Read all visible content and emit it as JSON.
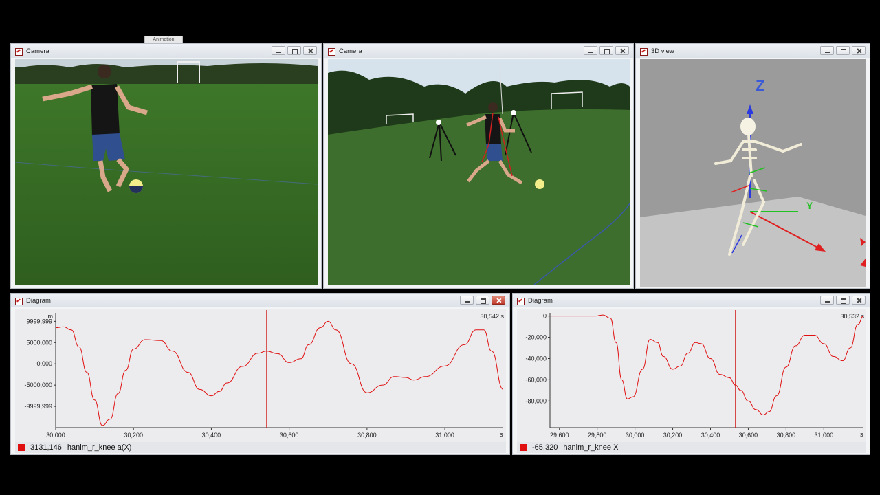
{
  "tooltip": "Animation",
  "windows": {
    "camera1": {
      "title": "Camera"
    },
    "camera2": {
      "title": "Camera"
    },
    "view3d": {
      "title": "3D view",
      "axis_z": "Z",
      "axis_y": "Y"
    },
    "diagram1": {
      "title": "Diagram",
      "unit": "m",
      "time_readout": "30,542 s",
      "y_ticks": [
        "9999,999",
        "5000,000",
        "0,000",
        "-5000,000",
        "-9999,999"
      ],
      "x_ticks": [
        "30,000",
        "30,200",
        "30,400",
        "30,600",
        "30,800",
        "31,000"
      ],
      "x_unit": "s",
      "footer_value": "3131,146",
      "footer_label": "hanim_r_knee a(X)",
      "series_color": "#e01010"
    },
    "diagram2": {
      "title": "Diagram",
      "time_readout": "30,532 s",
      "y_ticks": [
        "0",
        "-20,000",
        "-40,000",
        "-60,000",
        "-80,000"
      ],
      "x_ticks": [
        "29,600",
        "29,800",
        "30,000",
        "30,200",
        "30,400",
        "30,600",
        "30,800",
        "31,000"
      ],
      "x_unit": "s",
      "footer_value": "-65,320",
      "footer_label": "hanim_r_knee X",
      "series_color": "#e01010"
    }
  },
  "chart_data": [
    {
      "type": "line",
      "x": [
        30000,
        30020,
        30040,
        30060,
        30080,
        30100,
        30120,
        30140,
        30160,
        30180,
        30200,
        30230,
        30270,
        30300,
        30340,
        30370,
        30400,
        30420,
        30440,
        30480,
        30520,
        30542,
        30570,
        30600,
        30630,
        30650,
        30680,
        30700,
        30720,
        30760,
        30800,
        30840,
        30870,
        30900,
        30920,
        30950,
        31000,
        31050,
        31080,
        31100,
        31120,
        31150
      ],
      "series": [
        {
          "values": [
            8500,
            8700,
            8000,
            4000,
            -2000,
            -8500,
            -14500,
            -13000,
            -7000,
            -1500,
            3500,
            5700,
            5500,
            3000,
            -2000,
            -6000,
            -7500,
            -6500,
            -4500,
            -600,
            2500,
            3000,
            2400,
            300,
            1200,
            4500,
            8500,
            10000,
            8000,
            0,
            -6800,
            -5000,
            -3000,
            -3200,
            -3800,
            -3000,
            -500,
            4500,
            8000,
            8000,
            3000,
            -6000
          ]
        }
      ],
      "ylim": [
        -15000,
        12000
      ],
      "xlim": [
        30000,
        31150
      ],
      "cursor_x": 30542
    },
    {
      "type": "line",
      "x": [
        29550,
        29600,
        29700,
        29790,
        29830,
        29870,
        29900,
        29930,
        29960,
        29990,
        30040,
        30080,
        30120,
        30150,
        30200,
        30240,
        30280,
        30320,
        30350,
        30400,
        30450,
        30500,
        30532,
        30560,
        30600,
        30640,
        30680,
        30710,
        30750,
        30800,
        30850,
        30900,
        30950,
        31000,
        31050,
        31100,
        31140,
        31180,
        31210
      ],
      "series": [
        {
          "values": [
            0,
            0,
            0,
            0,
            1000,
            -2000,
            -25000,
            -60000,
            -78000,
            -76000,
            -50000,
            -22000,
            -25000,
            -38000,
            -50000,
            -47000,
            -35000,
            -25000,
            -26000,
            -40000,
            -55000,
            -58000,
            -65000,
            -70000,
            -80000,
            -88000,
            -93000,
            -90000,
            -75000,
            -48000,
            -28000,
            -18000,
            -18000,
            -26000,
            -38000,
            -42000,
            -30000,
            -8000,
            0
          ]
        }
      ],
      "ylim": [
        -105000,
        3000
      ],
      "xlim": [
        29550,
        31210
      ],
      "cursor_x": 30532
    }
  ]
}
